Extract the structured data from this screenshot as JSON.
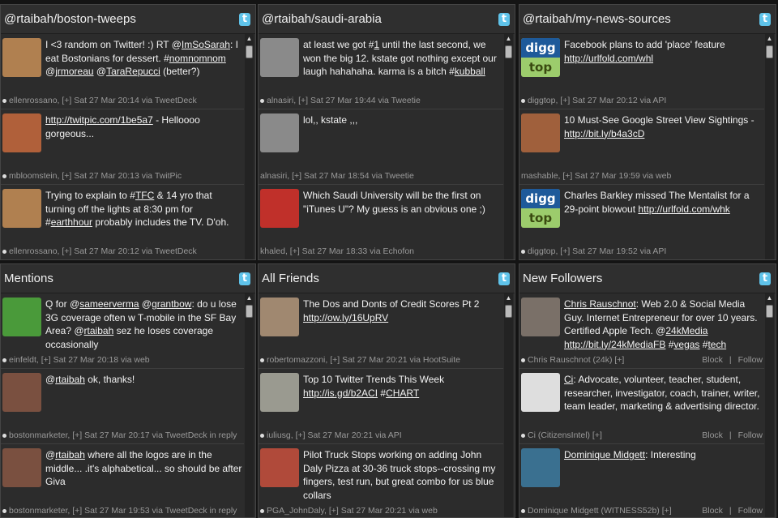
{
  "colors": {
    "accent": "#5fc3ea",
    "background": "#2c2c2c",
    "text": "#f2f2f2",
    "meta": "#9a9a9a"
  },
  "columns": [
    {
      "title": "@rtaibah/boston-tweeps",
      "icon": "twitter-icon",
      "tweets": [
        {
          "avatar": "#b08050",
          "text": [
            {
              "t": "I <3 random on Twitter! :) RT @"
            },
            {
              "t": "ImSoSarah",
              "link": true
            },
            {
              "t": ": I eat Bostonians for dessert. #"
            },
            {
              "t": "nomnomnom",
              "link": true
            },
            {
              "t": " @"
            },
            {
              "t": "jrmoreau",
              "link": true
            },
            {
              "t": " @"
            },
            {
              "t": "TaraRepucci",
              "link": true
            },
            {
              "t": " (better?)"
            }
          ],
          "meta": "ellenrossano, [+] Sat 27 Mar 20:14 via TweetDeck",
          "dot": true
        },
        {
          "avatar": "#b0603a",
          "text": [
            {
              "t": "http://twitpic.com/1be5a7",
              "link": true
            },
            {
              "t": " - Helloooo gorgeous..."
            }
          ],
          "meta": "mbloomstein, [+] Sat 27 Mar 20:13 via TwitPic",
          "dot": true
        },
        {
          "avatar": "#b08050",
          "text": [
            {
              "t": "Trying to explain to #"
            },
            {
              "t": "TFC",
              "link": true
            },
            {
              "t": " & 14 yro that turning off the lights at 8:30 pm for #"
            },
            {
              "t": "earthhour",
              "link": true
            },
            {
              "t": " probably includes the TV. D'oh."
            }
          ],
          "meta": "ellenrossano, [+] Sat 27 Mar 20:12 via TweetDeck",
          "dot": true
        }
      ]
    },
    {
      "title": "@rtaibah/saudi-arabia",
      "icon": "twitter-icon",
      "tweets": [
        {
          "avatar": "#8a8a8a",
          "text": [
            {
              "t": "at least we got #"
            },
            {
              "t": "1",
              "link": true
            },
            {
              "t": " until the last second, we won the big 12. kstate got nothing except our laugh hahahaha. karma is a bitch #"
            },
            {
              "t": "kubball",
              "link": true
            }
          ],
          "meta": "alnasiri, [+] Sat 27 Mar 19:44 via Tweetie",
          "dot": true
        },
        {
          "avatar": "#8a8a8a",
          "text": [
            {
              "t": "lol,, kstate ,,,"
            }
          ],
          "meta": "alnasiri, [+] Sat 27 Mar 18:54 via Tweetie",
          "dot": false
        },
        {
          "avatar": "#c0302a",
          "text": [
            {
              "t": "Which Saudi University will be the first on \"iTunes U\"? My guess is an obvious one ;)"
            }
          ],
          "meta": "khaled, [+] Sat 27 Mar 18:33 via Echofon",
          "dot": false
        }
      ]
    },
    {
      "title": "@rtaibah/my-news-sources",
      "icon": "twitter-icon",
      "tweets": [
        {
          "avatar": "digg",
          "text": [
            {
              "t": "Facebook plans to add 'place' feature "
            },
            {
              "t": "http://urlfold.com/whl",
              "link": true
            }
          ],
          "meta": "diggtop, [+] Sat 27 Mar 20:12 via API",
          "dot": true
        },
        {
          "avatar": "#a0603c",
          "text": [
            {
              "t": "10 Must-See Google Street View Sightings - "
            },
            {
              "t": "http://bit.ly/b4a3cD",
              "link": true
            }
          ],
          "meta": "mashable, [+] Sat 27 Mar 19:59 via web",
          "dot": false
        },
        {
          "avatar": "digg",
          "text": [
            {
              "t": "Charles Barkley missed The Mentalist for a 29-point blowout "
            },
            {
              "t": "http://urlfold.com/whk",
              "link": true
            }
          ],
          "meta": "diggtop, [+] Sat 27 Mar 19:52 via API",
          "dot": true
        }
      ]
    },
    {
      "title": "Mentions",
      "icon": "twitter-icon",
      "tweets": [
        {
          "avatar": "#4a9a3a",
          "text": [
            {
              "t": "Q for @"
            },
            {
              "t": "sameerverma",
              "link": true
            },
            {
              "t": " @"
            },
            {
              "t": "grantbow",
              "link": true
            },
            {
              "t": ": do u lose 3G coverage often w T-mobile in the SF Bay Area? @"
            },
            {
              "t": "rtaibah",
              "link": true
            },
            {
              "t": " sez he loses coverage occasionally"
            }
          ],
          "meta": "einfeldt, [+] Sat 27 Mar 20:18 via web",
          "dot": true
        },
        {
          "avatar": "#7a5040",
          "text": [
            {
              "t": "@"
            },
            {
              "t": "rtaibah",
              "link": true
            },
            {
              "t": " ok, thanks!"
            }
          ],
          "meta": "bostonmarketer, [+] Sat 27 Mar 20:17 via TweetDeck in reply",
          "dot": true
        },
        {
          "avatar": "#7a5040",
          "text": [
            {
              "t": "@"
            },
            {
              "t": "rtaibah",
              "link": true
            },
            {
              "t": " where all the logos are in the middle... .it's alphabetical... so should be after Giva"
            }
          ],
          "meta": "bostonmarketer, [+] Sat 27 Mar 19:53 via TweetDeck in reply",
          "dot": true
        }
      ]
    },
    {
      "title": "All Friends",
      "icon": "twitter-icon",
      "tweets": [
        {
          "avatar": "#a08870",
          "text": [
            {
              "t": "The Dos and Donts of Credit Scores Pt 2 "
            },
            {
              "t": "http://ow.ly/16UpRV",
              "link": true
            }
          ],
          "meta": "robertomazzoni, [+] Sat 27 Mar 20:21 via HootSuite",
          "dot": true
        },
        {
          "avatar": "#9a9a90",
          "text": [
            {
              "t": "Top 10 Twitter Trends This Week "
            },
            {
              "t": "http://is.gd/b2ACI",
              "link": true
            },
            {
              "t": " #"
            },
            {
              "t": "CHART",
              "link": true
            }
          ],
          "meta": "iuliusg, [+] Sat 27 Mar 20:21 via API",
          "dot": true
        },
        {
          "avatar": "#b04a3a",
          "text": [
            {
              "t": "Pilot Truck Stops working on adding John Daly Pizza at 30-36 truck stops--crossing my fingers, test run, but great combo for us blue collars"
            }
          ],
          "meta": "PGA_JohnDaly, [+] Sat 27 Mar 20:21 via web",
          "dot": true
        }
      ]
    },
    {
      "title": "New Followers",
      "icon": "twitter-icon",
      "tweets": [
        {
          "avatar": "#7a7068",
          "text": [
            {
              "t": "Chris Rauschnot",
              "link": true
            },
            {
              "t": ": Web 2.0 & Social Media Guy. Internet Entrepreneur for over 10 years. Certified Apple Tech. @"
            },
            {
              "t": "24kMedia",
              "link": true
            },
            {
              "t": " "
            },
            {
              "t": "http://bit.ly/24kMediaFB",
              "link": true
            },
            {
              "t": " #"
            },
            {
              "t": "vegas",
              "link": true
            },
            {
              "t": " #"
            },
            {
              "t": "tech",
              "link": true
            }
          ],
          "meta": "Chris Rauschnot (24k)  [+]",
          "dot": true,
          "actions": [
            "Block",
            "|",
            "Follow"
          ]
        },
        {
          "avatar": "#dedede",
          "text": [
            {
              "t": "Ci",
              "link": true
            },
            {
              "t": ": Advocate, volunteer, teacher, student, researcher, investigator, coach, trainer, writer, team leader, marketing & advertising director."
            }
          ],
          "meta": "Ci (CitizensIntel)  [+]",
          "dot": true,
          "actions": [
            "Block",
            "|",
            "Follow"
          ]
        },
        {
          "avatar": "#3a7090",
          "text": [
            {
              "t": "Dominique Midgett",
              "link": true
            },
            {
              "t": ": Interesting"
            }
          ],
          "meta": "Dominique Midgett (WITNESS52b)  [+]",
          "dot": true,
          "actions": [
            "Block",
            "|",
            "Follow"
          ]
        }
      ]
    }
  ]
}
